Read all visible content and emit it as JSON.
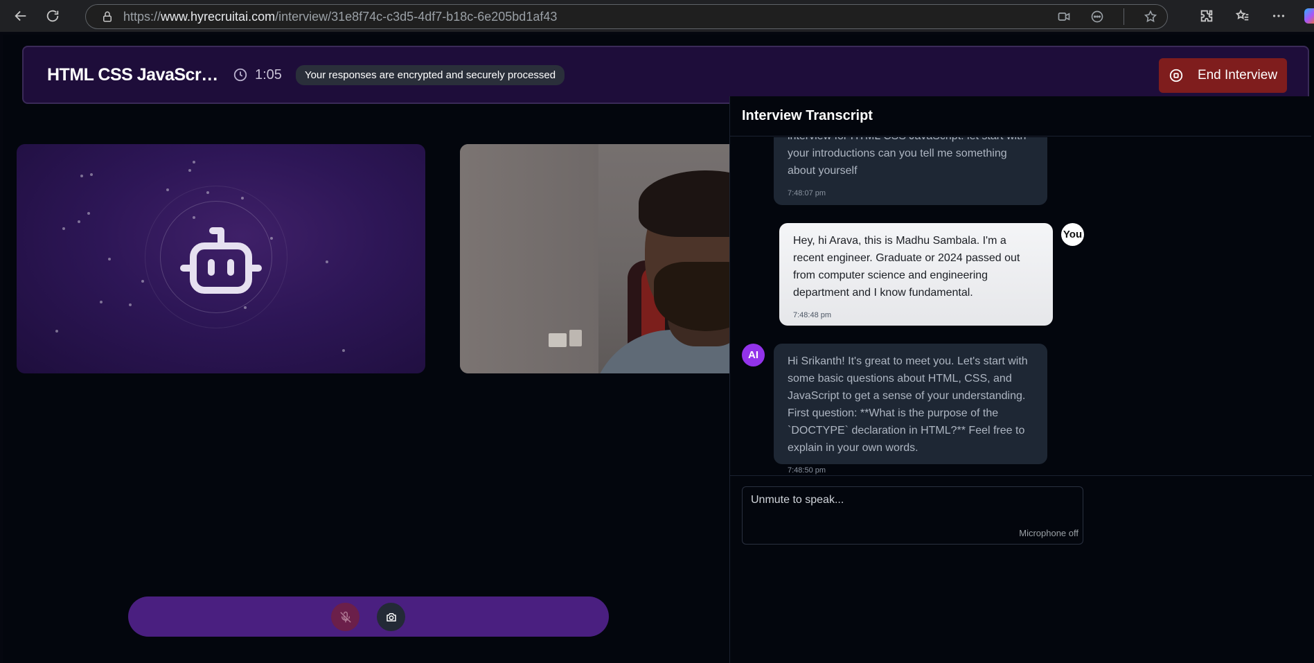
{
  "browser": {
    "url_prefix": "https://",
    "url_host": "www.hyrecruitai.com",
    "url_path": "/interview/31e8f74c-c3d5-4df7-b18c-6e205bd1af43"
  },
  "header": {
    "title": "HTML CSS JavaScript",
    "timer": "1:05",
    "secure_note": "Your responses are encrypted and securely processed",
    "end_button": "End Interview",
    "end_button_color": "#7f1d1d"
  },
  "colors": {
    "header_bg": "#1e0d3a",
    "accent_purple": "#9333ea",
    "controls_bar": "#4a1f80",
    "mic_muted": "#6b1f4a"
  },
  "transcript": {
    "title": "Interview Transcript",
    "messages": [
      {
        "sender": "ai",
        "text": "interview for HTML CSS JavaScript. let start with your introductions can you tell me something about yourself",
        "time": "7:48:07 pm"
      },
      {
        "sender": "user",
        "avatar": "You",
        "text": "Hey, hi Arava, this is Madhu Sambala. I'm a recent engineer. Graduate or 2024 passed out from computer science and engineering department and I know fundamental.",
        "time": "7:48:48 pm"
      },
      {
        "sender": "ai",
        "avatar": "AI",
        "text": "Hi Srikanth! It's great to meet you. Let's start with some basic questions about HTML, CSS, and JavaScript to get a sense of your understanding. First question: **What is the purpose of the `DOCTYPE` declaration in HTML?** Feel free to explain in your own words.",
        "time": "7:48:50 pm"
      }
    ],
    "input_placeholder": "Unmute to speak...",
    "mic_status": "Microphone off"
  },
  "icons": {
    "back": "arrow-left-icon",
    "refresh": "refresh-icon",
    "lock": "lock-icon",
    "clock": "clock-icon",
    "stop": "stop-circle-icon",
    "robot": "robot-icon",
    "mic_off": "mic-off-icon",
    "camera": "camera-icon"
  }
}
